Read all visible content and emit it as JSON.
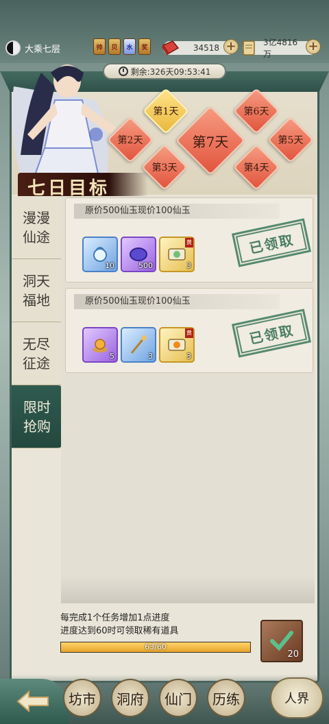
{
  "top": {
    "realm": "大乘七层",
    "badges": [
      "帅",
      "贝",
      "水",
      "奖"
    ],
    "jade": "34518",
    "gold": "3亿4816万",
    "plus": "+"
  },
  "timer": "剩余:326天09:53:41",
  "event_title": "七日目标",
  "days": [
    "第1天",
    "第2天",
    "第3天",
    "第4天",
    "第5天",
    "第6天",
    "第7天"
  ],
  "tabs": [
    "漫漫\n仙途",
    "洞天\n福地",
    "无尽\n征途",
    "限时\n抢购"
  ],
  "cards": [
    {
      "title": "原价500仙玉现价100仙玉",
      "items": [
        {
          "count": "10",
          "rarity": "blue"
        },
        {
          "count": "500",
          "rarity": "purple"
        },
        {
          "count": "3",
          "rarity": "gold",
          "tag": "黄"
        }
      ],
      "status": "已领取"
    },
    {
      "title": "原价500仙玉现价100仙玉",
      "items": [
        {
          "count": "5",
          "rarity": "purple"
        },
        {
          "count": "3",
          "rarity": "blue"
        },
        {
          "count": "3",
          "rarity": "gold",
          "tag": "黄"
        }
      ],
      "status": "已领取"
    }
  ],
  "progress": {
    "line1": "每完成1个任务增加1点进度",
    "line2": "进度达到60时可领取稀有道具",
    "text": "63/60",
    "value": 63,
    "max": 60,
    "reward_count": "20"
  },
  "nav": [
    "历练",
    "仙门",
    "洞府",
    "坊市",
    "人界"
  ]
}
